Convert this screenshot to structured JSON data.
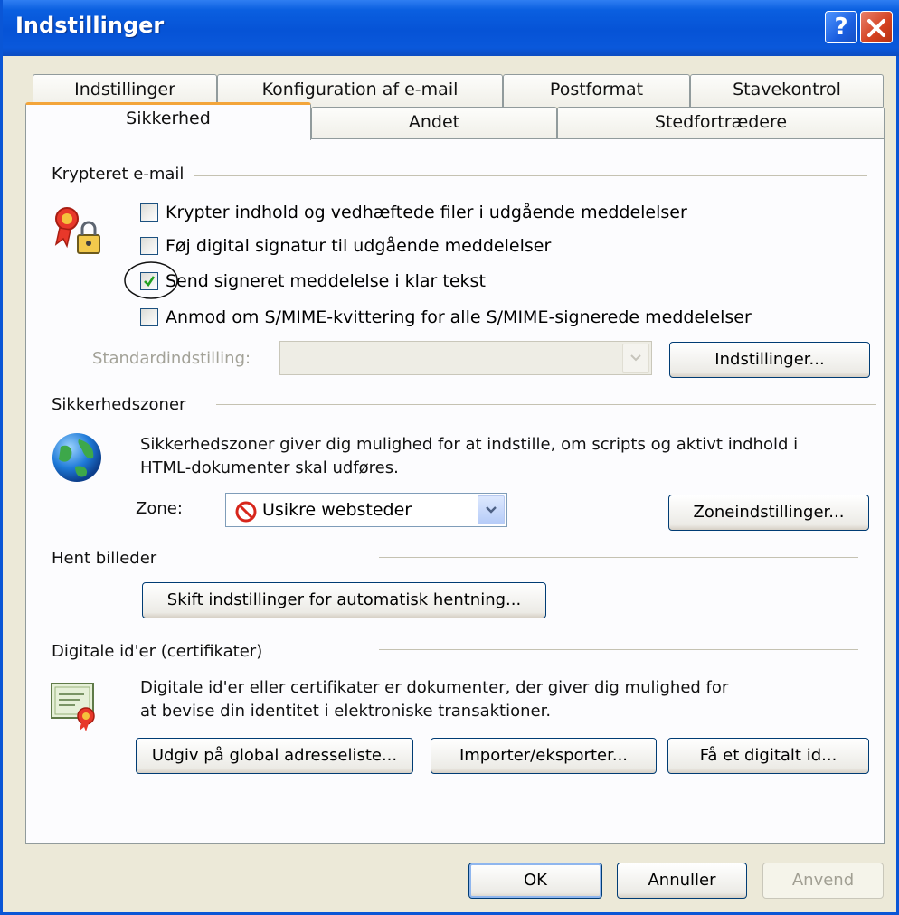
{
  "window": {
    "title": "Indstillinger"
  },
  "tabs_back": [
    "Indstillinger",
    "Konfiguration af e-mail",
    "Postformat",
    "Stavekontrol"
  ],
  "tabs_front": [
    "Sikkerhed",
    "Andet",
    "Stedfortrædere"
  ],
  "encrypted_email": {
    "heading": "Krypteret e-mail",
    "options": [
      {
        "label": "Krypter indhold og vedhæftede filer i udgående meddelelser",
        "checked": false
      },
      {
        "label": "Føj digital signatur til udgående meddelelser",
        "checked": false
      },
      {
        "label": "Send signeret meddelelse i klar tekst",
        "checked": true
      },
      {
        "label": "Anmod om S/MIME-kvittering for alle S/MIME-signerede meddelelser",
        "checked": false
      }
    ],
    "default_setting_label": "Standardindstilling:",
    "default_setting_value": "",
    "settings_button": "Indstillinger..."
  },
  "security_zones": {
    "heading": "Sikkerhedszoner",
    "description_line1": "Sikkerhedszoner giver dig mulighed for at indstille, om scripts og aktivt indhold i",
    "description_line2": "HTML-dokumenter skal udføres.",
    "zone_label": "Zone:",
    "zone_value": "Usikre websteder",
    "zone_settings_button": "Zoneindstillinger..."
  },
  "download_pictures": {
    "heading": "Hent billeder",
    "button": "Skift indstillinger for automatisk hentning..."
  },
  "digital_ids": {
    "heading": "Digitale id'er (certifikater)",
    "description_line1": "Digitale id'er eller certifikater er dokumenter, der giver dig mulighed for",
    "description_line2": "at bevise din identitet i elektroniske transaktioner.",
    "publish_button": "Udgiv på global adresseliste...",
    "import_export_button": "Importer/eksporter...",
    "get_id_button": "Få et digitalt id..."
  },
  "footer": {
    "ok": "OK",
    "cancel": "Annuller",
    "apply": "Anvend"
  },
  "colors": {
    "title_bar": "#0653d6",
    "dialog_bg": "#ece9d8",
    "tab_highlight": "#f3a53a",
    "check": "#21a121"
  }
}
